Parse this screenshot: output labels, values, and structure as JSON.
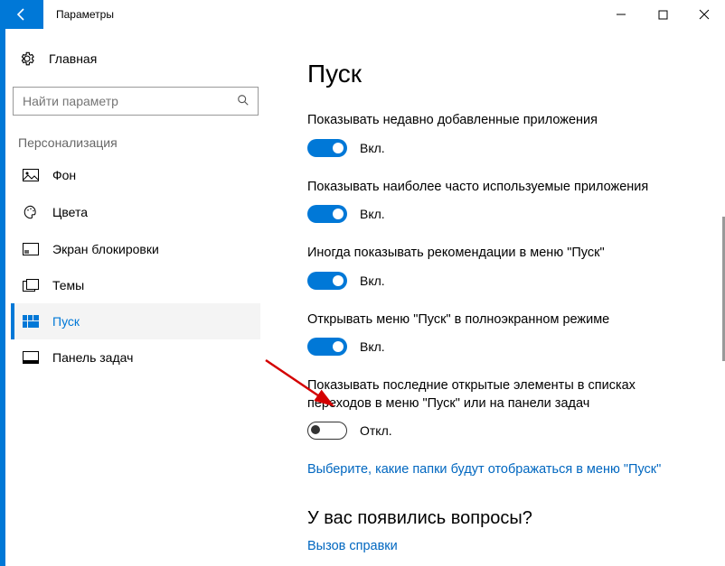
{
  "titlebar": {
    "app_name": "Параметры"
  },
  "sidebar": {
    "home_label": "Главная",
    "search_placeholder": "Найти параметр",
    "section_title": "Персонализация",
    "items": [
      {
        "label": "Фон"
      },
      {
        "label": "Цвета"
      },
      {
        "label": "Экран блокировки"
      },
      {
        "label": "Темы"
      },
      {
        "label": "Пуск"
      },
      {
        "label": "Панель задач"
      }
    ]
  },
  "main": {
    "heading": "Пуск",
    "settings": [
      {
        "label": "Показывать недавно добавленные приложения",
        "on": true
      },
      {
        "label": "Показывать наиболее часто используемые приложения",
        "on": true
      },
      {
        "label": "Иногда показывать рекомендации в меню \"Пуск\"",
        "on": true
      },
      {
        "label": "Открывать меню \"Пуск\" в полноэкранном режиме",
        "on": true
      },
      {
        "label": "Показывать последние открытые элементы в списках переходов в меню \"Пуск\" или на панели задач",
        "on": false
      }
    ],
    "toggle_on_text": "Вкл.",
    "toggle_off_text": "Откл.",
    "folders_link": "Выберите, какие папки будут отображаться в меню \"Пуск\"",
    "questions_heading": "У вас появились вопросы?",
    "help_link": "Вызов справки"
  }
}
